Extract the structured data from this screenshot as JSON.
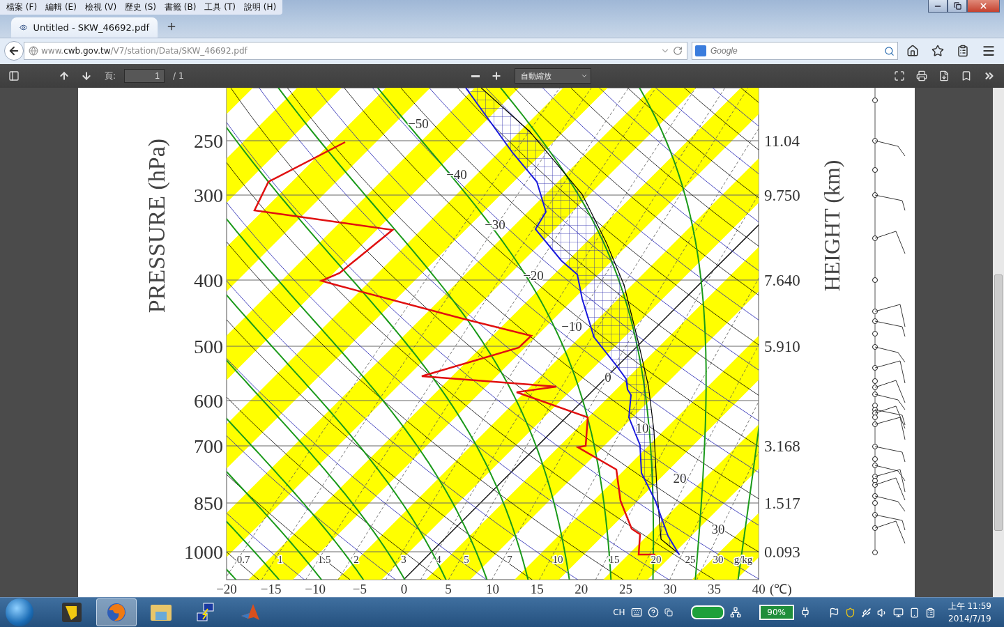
{
  "menu_bar": [
    "檔案 (F)",
    "編輯 (E)",
    "檢視 (V)",
    "歷史 (S)",
    "書籤 (B)",
    "工具 (T)",
    "說明 (H)"
  ],
  "tabs": [
    {
      "title": "Untitled - SKW_46692.pdf",
      "selected": true
    }
  ],
  "address_bar": {
    "url": "www.**cwb.gov.tw**/V7/station/Data/SKW_46692.pdf"
  },
  "search_field": {
    "placeholder": "Google"
  },
  "pdf_toolbar": {
    "page_label": "頁:",
    "page_value": "1",
    "page_total": "/ 1",
    "zoom": "自動縮放"
  },
  "diagram": {
    "pressure_title": "PRESSURE (hPa)",
    "height_title": "HEIGHT (km)",
    "pressure_labels": [
      "250",
      "300",
      "400",
      "500",
      "600",
      "700",
      "850",
      "1000"
    ],
    "height_labels": [
      "11.04",
      "9.750",
      "7.640",
      "5.910",
      "3.168",
      "1.517",
      "0.093"
    ],
    "temperature_labels": [
      "−20",
      "−15",
      "−10",
      "−5",
      "0",
      "5",
      "10",
      "15",
      "20",
      "25",
      "30",
      "35",
      "40"
    ],
    "temperature_unit": "(℃)",
    "mixing_ratio_labels": [
      "0.7",
      "1",
      "1.5",
      "2",
      "3",
      "4",
      "5",
      "7",
      "10",
      "15",
      "20",
      "25",
      "30"
    ],
    "mixing_ratio_unit": "g/kg",
    "isotherm_labels": [
      "−50",
      "−40",
      "−30",
      "−20",
      "−10",
      "0",
      "10",
      "20",
      "30"
    ]
  },
  "taskbar": {
    "apps": [
      {
        "kind": "tool",
        "selected": false
      },
      {
        "kind": "browser",
        "selected": true
      },
      {
        "kind": "folder",
        "selected": false
      },
      {
        "kind": "network",
        "selected": false
      },
      {
        "kind": "math",
        "selected": false
      }
    ],
    "language": "CH",
    "battery": "90%",
    "time": "上午 11:59",
    "date": "2014/7/19"
  }
}
